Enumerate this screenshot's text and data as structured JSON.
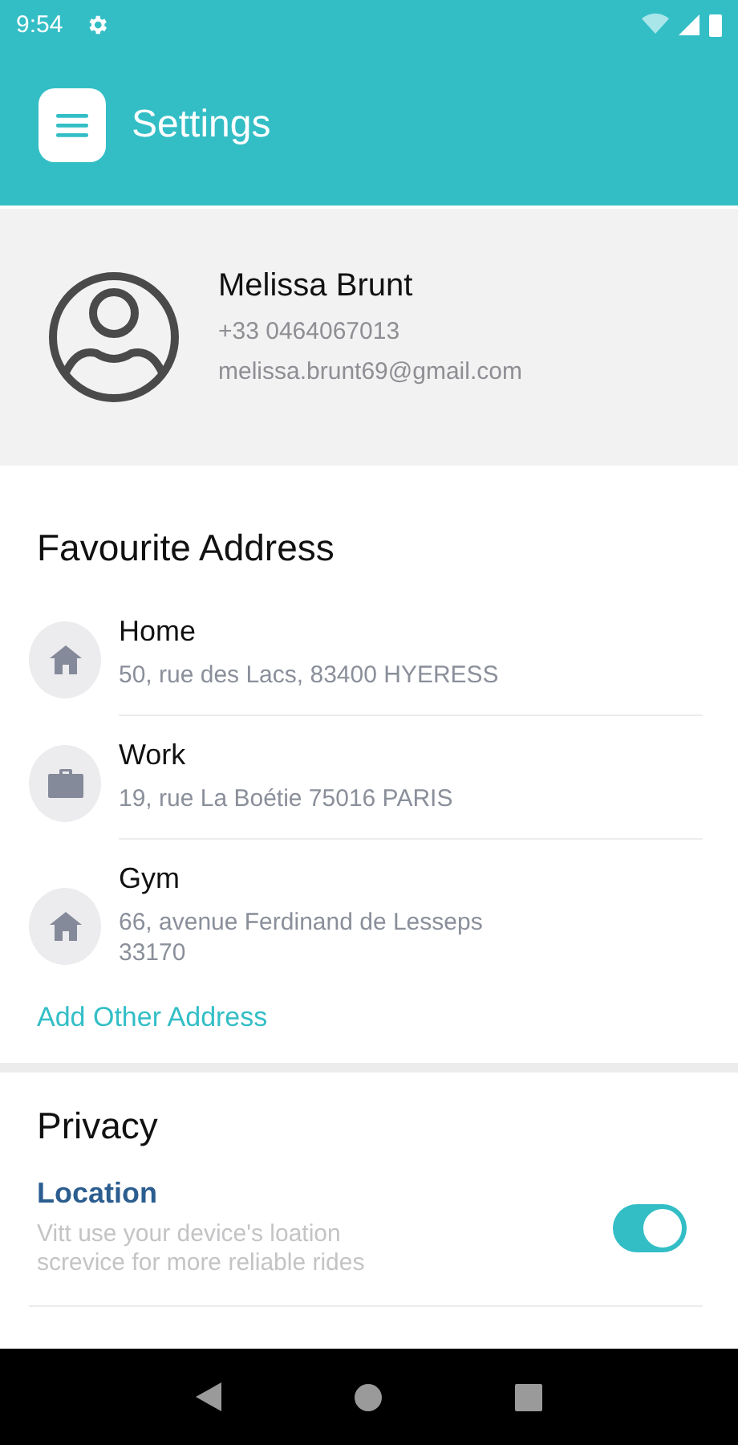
{
  "status_bar": {
    "time": "9:54"
  },
  "header": {
    "title": "Settings"
  },
  "profile": {
    "name": "Melissa Brunt",
    "phone": "+33 0464067013",
    "email": "melissa.brunt69@gmail.com"
  },
  "favourites": {
    "title": "Favourite Address",
    "addresses": [
      {
        "kind": "home",
        "label": "Home",
        "address": "50, rue des Lacs, 83400 HYERESS"
      },
      {
        "kind": "work",
        "label": "Work",
        "address": "19, rue La Boétie 75016 PARIS"
      },
      {
        "kind": "home",
        "label": "Gym",
        "address": "66, avenue Ferdinand de Lesseps 33170"
      }
    ],
    "add_link": "Add Other Address"
  },
  "privacy": {
    "title": "Privacy",
    "settings": [
      {
        "label": "Location",
        "description": "Vitt use your device's loation screvice for more  reliable rides",
        "on": true
      }
    ]
  }
}
